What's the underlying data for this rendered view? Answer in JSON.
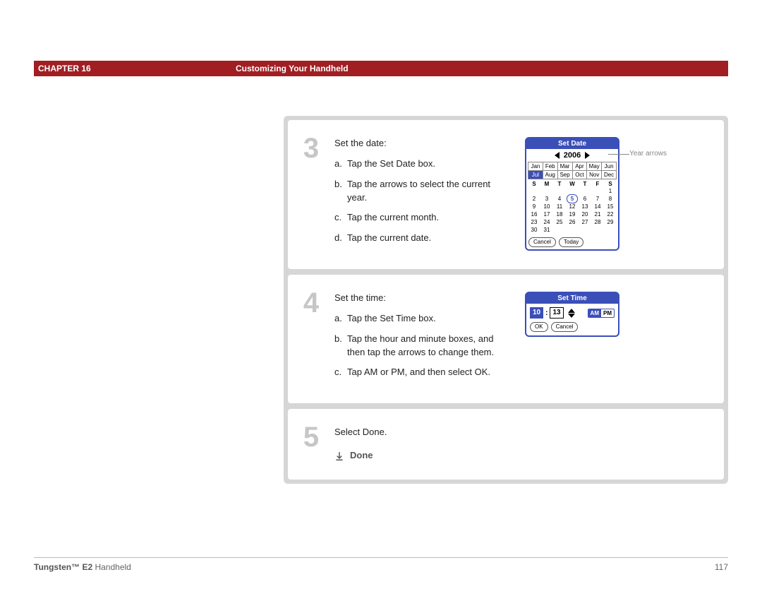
{
  "header": {
    "chapter": "CHAPTER 16",
    "title": "Customizing Your Handheld"
  },
  "steps": {
    "s3": {
      "num": "3",
      "lead": "Set the date:",
      "a": "Tap the Set Date box.",
      "b": "Tap the arrows to select the current year.",
      "c": "Tap the current month.",
      "d": "Tap the current date."
    },
    "s4": {
      "num": "4",
      "lead": "Set the time:",
      "a": "Tap the Set Time box.",
      "b": "Tap the hour and minute boxes, and then tap the arrows to change them.",
      "c": "Tap AM or PM, and then select OK."
    },
    "s5": {
      "num": "5",
      "lead": "Select Done.",
      "done": "Done"
    }
  },
  "callout": {
    "year_arrows": "Year arrows"
  },
  "set_date": {
    "title": "Set Date",
    "year": "2006",
    "months": [
      "Jan",
      "Feb",
      "Mar",
      "Apr",
      "May",
      "Jun",
      "Jul",
      "Aug",
      "Sep",
      "Oct",
      "Nov",
      "Dec"
    ],
    "selected_month_index": 6,
    "dow": [
      "S",
      "M",
      "T",
      "W",
      "T",
      "F",
      "S"
    ],
    "selected_day": 5,
    "cancel": "Cancel",
    "today": "Today"
  },
  "set_time": {
    "title": "Set Time",
    "hour": "10",
    "minute": "13",
    "am": "AM",
    "pm": "PM",
    "ampm_selected": "AM",
    "ok": "OK",
    "cancel": "Cancel"
  },
  "footer": {
    "product_bold": "Tungsten™ E2",
    "product_rest": " Handheld",
    "page": "117"
  },
  "chart_data": {
    "type": "table",
    "title": "Set Date — July 2006 calendar",
    "columns": [
      "S",
      "M",
      "T",
      "W",
      "T",
      "F",
      "S"
    ],
    "rows": [
      [
        "",
        "",
        "",
        "",
        "",
        "",
        "1"
      ],
      [
        "2",
        "3",
        "4",
        "5",
        "6",
        "7",
        "8"
      ],
      [
        "9",
        "10",
        "11",
        "12",
        "13",
        "14",
        "15"
      ],
      [
        "16",
        "17",
        "18",
        "19",
        "20",
        "21",
        "22"
      ],
      [
        "23",
        "24",
        "25",
        "26",
        "27",
        "28",
        "29"
      ],
      [
        "30",
        "31",
        "",
        "",
        "",
        "",
        ""
      ]
    ],
    "selected": {
      "row": 1,
      "col": 3,
      "value": 5
    }
  }
}
